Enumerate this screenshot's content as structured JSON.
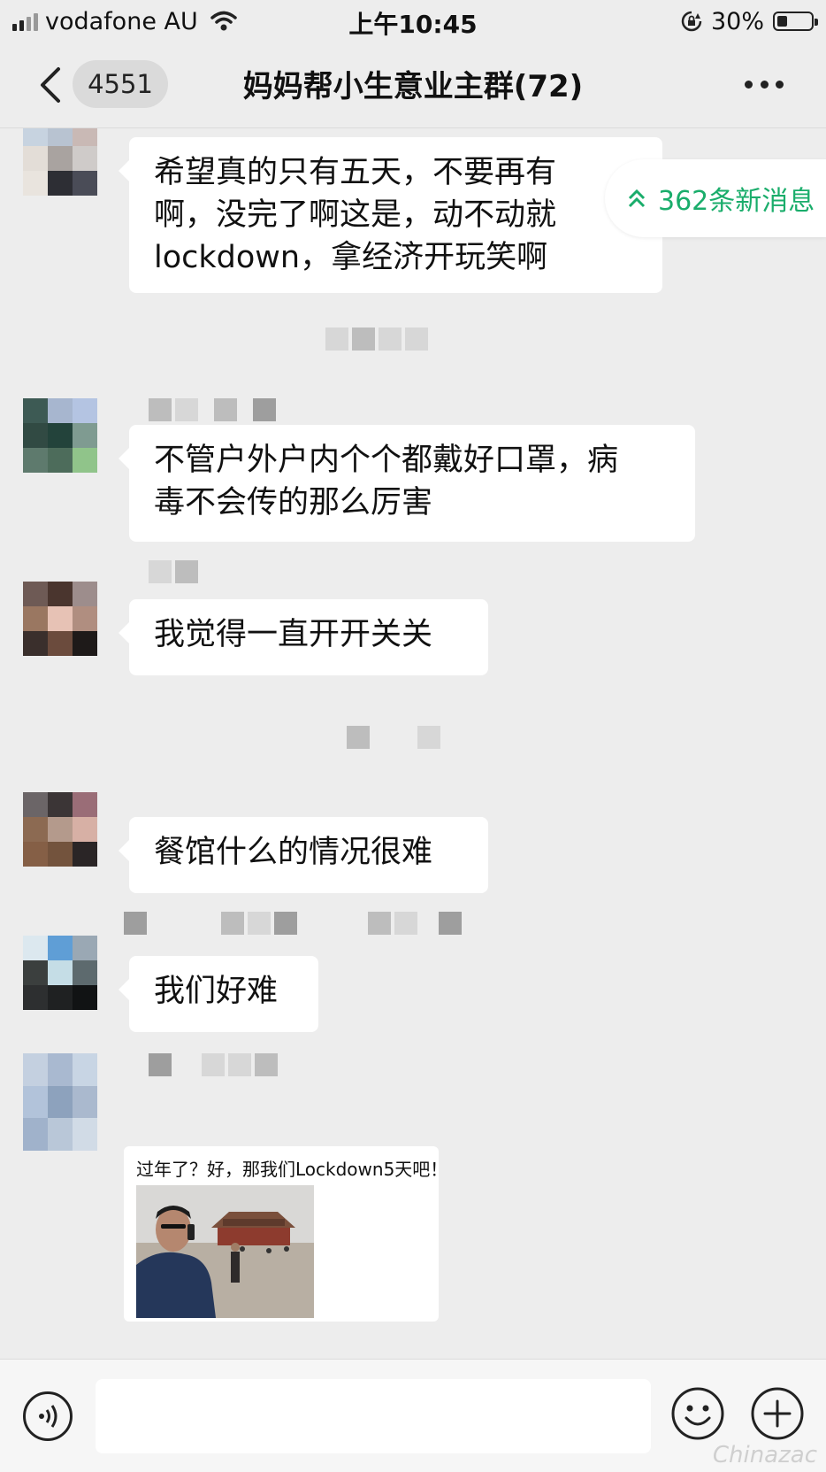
{
  "status_bar": {
    "carrier": "vodafone AU",
    "time": "上午10:45",
    "battery_percent": "30%",
    "battery_level": 0.3,
    "icons": [
      "signal-icon",
      "wifi-icon",
      "rotation-lock-icon",
      "battery-icon"
    ]
  },
  "nav": {
    "unread_count": "4551",
    "title": "妈妈帮小生意业主群(72)",
    "icons": [
      "back-icon",
      "more-icon"
    ]
  },
  "new_messages_indicator": "362条新消息",
  "messages": [
    {
      "type": "text",
      "text": "希望真的只有五天，不要再有\n啊，没完了啊这是，动不动就\nlockdown，拿经济开玩笑啊"
    },
    {
      "type": "text",
      "text": "不管户外户内个个都戴好口罩，病\n毒不会传的那么厉害"
    },
    {
      "type": "text",
      "text": "我觉得一直开开关关"
    },
    {
      "type": "text",
      "text": "餐馆什么的情况很难"
    },
    {
      "type": "text",
      "text": "我们好难"
    },
    {
      "type": "image",
      "caption": "过年了？好，那我们Lockdown5天吧！"
    }
  ],
  "input_bar": {
    "placeholder": "",
    "icons": [
      "voice-icon",
      "emoji-icon",
      "plus-icon"
    ]
  },
  "watermark": "Chinazac",
  "colors": {
    "background": "#ededed",
    "bubble": "#ffffff",
    "accent_green": "#1aad6b"
  }
}
